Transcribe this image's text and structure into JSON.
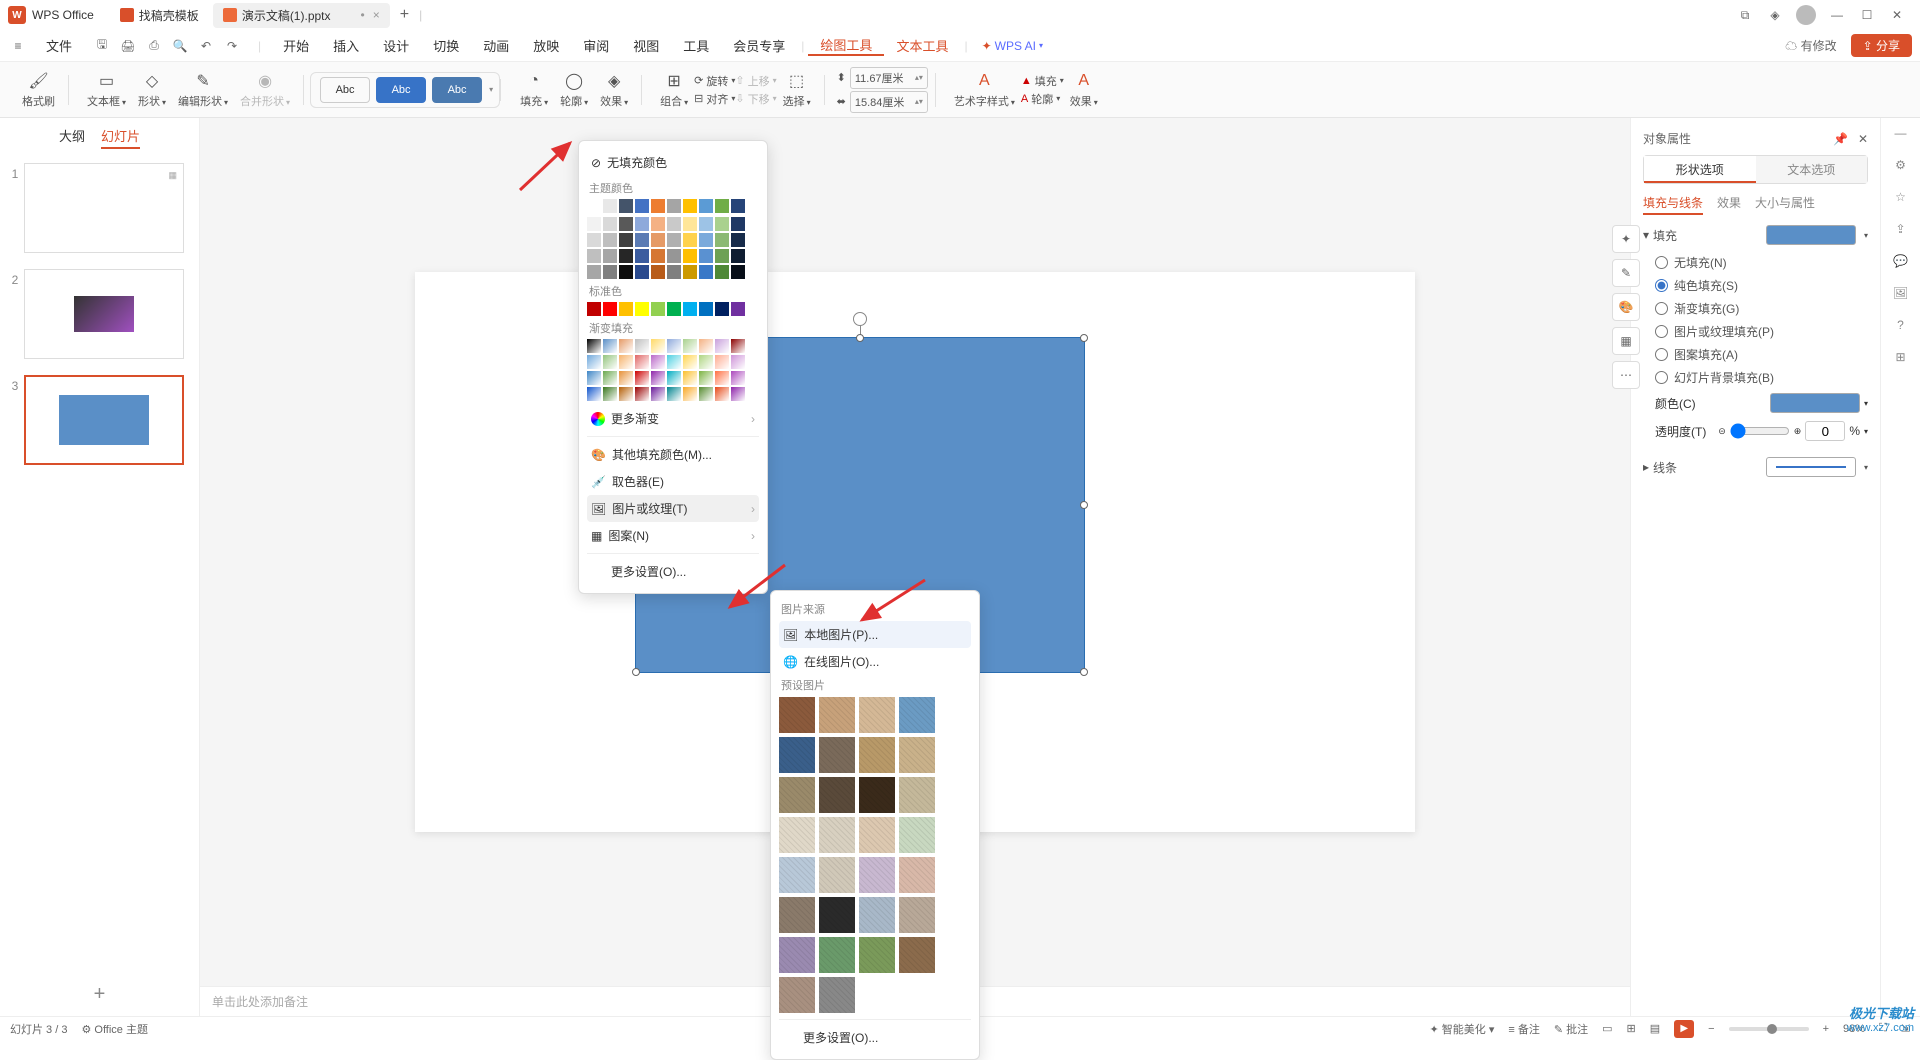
{
  "app_name": "WPS Office",
  "tabs": [
    {
      "label": "找稿壳模板",
      "icon": "#d94f2a"
    },
    {
      "label": "演示文稿(1).pptx",
      "icon": "#ed6a3a",
      "active": true
    }
  ],
  "menubar": {
    "file": "文件",
    "items": [
      "开始",
      "插入",
      "设计",
      "切换",
      "动画",
      "放映",
      "审阅",
      "视图",
      "工具",
      "会员专享"
    ],
    "active1": "绘图工具",
    "active2": "文本工具",
    "ai": "WPS AI",
    "modify": "有修改",
    "share": "分享"
  },
  "ribbon": {
    "format_painter": "格式刷",
    "textbox": "文本框",
    "shape": "形状",
    "edit_shape": "编辑形状",
    "merge_shape": "合并形状",
    "style_abc": "Abc",
    "fill": "填充",
    "outline": "轮廓",
    "effect": "效果",
    "group": "组合",
    "rotate": "旋转",
    "align": "对齐",
    "up": "上移",
    "down": "下移",
    "select": "选择",
    "height": "11.67厘米",
    "width": "15.84厘米",
    "art_style": "艺术字样式",
    "fill2": "填充",
    "outline2": "轮廓",
    "effect2": "效果"
  },
  "leftpanel": {
    "outline": "大纲",
    "slides": "幻灯片",
    "count": 3
  },
  "fillpopup": {
    "nofill": "无填充颜色",
    "theme": "主题颜色",
    "standard": "标准色",
    "gradient": "渐变填充",
    "more_grad": "更多渐变",
    "other_color": "其他填充颜色(M)...",
    "eyedropper": "取色器(E)",
    "picture": "图片或纹理(T)",
    "pattern": "图案(N)",
    "more": "更多设置(O)..."
  },
  "picpopup": {
    "source": "图片来源",
    "local": "本地图片(P)...",
    "online": "在线图片(O)...",
    "preset": "预设图片",
    "more": "更多设置(O)..."
  },
  "rightpanel": {
    "title": "对象属性",
    "tab_shape": "形状选项",
    "tab_text": "文本选项",
    "sub_fill": "填充与线条",
    "sub_effect": "效果",
    "sub_size": "大小与属性",
    "fill_hdr": "填充",
    "radios": {
      "none": "无填充(N)",
      "solid": "纯色填充(S)",
      "gradient": "渐变填充(G)",
      "picture": "图片或纹理填充(P)",
      "pattern": "图案填充(A)",
      "slide_bg": "幻灯片背景填充(B)"
    },
    "color": "颜色(C)",
    "transparency": "透明度(T)",
    "trans_val": "0",
    "pct": "%",
    "line_hdr": "线条"
  },
  "notes_placeholder": "单击此处添加备注",
  "statusbar": {
    "slide": "幻灯片 3 / 3",
    "theme": "Office 主题",
    "beautify": "智能美化",
    "notes": "备注",
    "comment": "批注",
    "zoom": "98%"
  },
  "theme_colors": [
    "#ffffff",
    "#e8e8e8",
    "#44546a",
    "#4472c4",
    "#ed7d31",
    "#a5a5a5",
    "#ffc000",
    "#5b9bd5",
    "#70ad47",
    "#264478"
  ],
  "theme_shades": [
    [
      "#f2f2f2",
      "#d9d9d9",
      "#595959",
      "#8ea9db",
      "#f4b184",
      "#c9c9c9",
      "#ffe699",
      "#9dc3e6",
      "#a9d18e",
      "#1f3864"
    ],
    [
      "#d9d9d9",
      "#bfbfbf",
      "#404040",
      "#5b7bb4",
      "#e59a66",
      "#b0b0b0",
      "#ffd24d",
      "#7baadb",
      "#8bb973",
      "#172b4a"
    ],
    [
      "#bfbfbf",
      "#a6a6a6",
      "#262626",
      "#3b5c9f",
      "#d67733",
      "#969696",
      "#ffbf00",
      "#5a91d1",
      "#6da154",
      "#0f1d31"
    ],
    [
      "#a6a6a6",
      "#808080",
      "#0d0d0d",
      "#2a4a8e",
      "#b85c1a",
      "#7f7f7f",
      "#cc9900",
      "#3978c7",
      "#4f8936",
      "#070e18"
    ]
  ],
  "standard_colors": [
    "#c00000",
    "#ff0000",
    "#ffc000",
    "#ffff00",
    "#92d050",
    "#00b050",
    "#00b0f0",
    "#0070c0",
    "#002060",
    "#7030a0"
  ],
  "gradients": [
    [
      "#000000",
      "#5a8fc7",
      "#e59a66",
      "#bfbfbf",
      "#ffd966",
      "#8faadc",
      "#a9d18e",
      "#f4b183",
      "#c9a0dc",
      "#8b0000"
    ],
    [
      "#6fa8dc",
      "#93c47d",
      "#f6b26b",
      "#e06666",
      "#ba68c8",
      "#4dd0e1",
      "#ffd54f",
      "#aed581",
      "#ffab91",
      "#ce93d8"
    ],
    [
      "#3d85c6",
      "#6aa84f",
      "#e69138",
      "#cc0000",
      "#8e24aa",
      "#00acc1",
      "#fbc02d",
      "#7cb342",
      "#ff7043",
      "#ab47bc"
    ],
    [
      "#1155cc",
      "#38761d",
      "#b45f06",
      "#990000",
      "#6a1b9a",
      "#00838f",
      "#f9a825",
      "#558b2f",
      "#e64a19",
      "#8e24aa"
    ]
  ],
  "textures": [
    [
      "#8b5a3c",
      "#c7a17a",
      "#d4b896",
      "#6b9bc3",
      "#3a5f8a",
      "#7a6a5a"
    ],
    [
      "#b89968",
      "#c9b18a",
      "#9a8a6a",
      "#5a4a3a",
      "#3a2a1a",
      "#c4b89a"
    ],
    [
      "#e0d8c8",
      "#d8d0c0",
      "#dcc8b0",
      "#c8d8c0",
      "#b8c8d8",
      "#d0c8b8"
    ],
    [
      "#c8b8d0",
      "#d8b8a8",
      "#8a7a6a",
      "#2a2a2a",
      "#a8b8c8",
      "#b8a898"
    ],
    [
      "#9a8ab0",
      "#6a9a6a",
      "#7a9a5a",
      "#8b6b4c",
      "#a89080",
      "#888888"
    ]
  ],
  "watermark": {
    "brand": "极光下载站",
    "url": "www.xz7.com"
  }
}
